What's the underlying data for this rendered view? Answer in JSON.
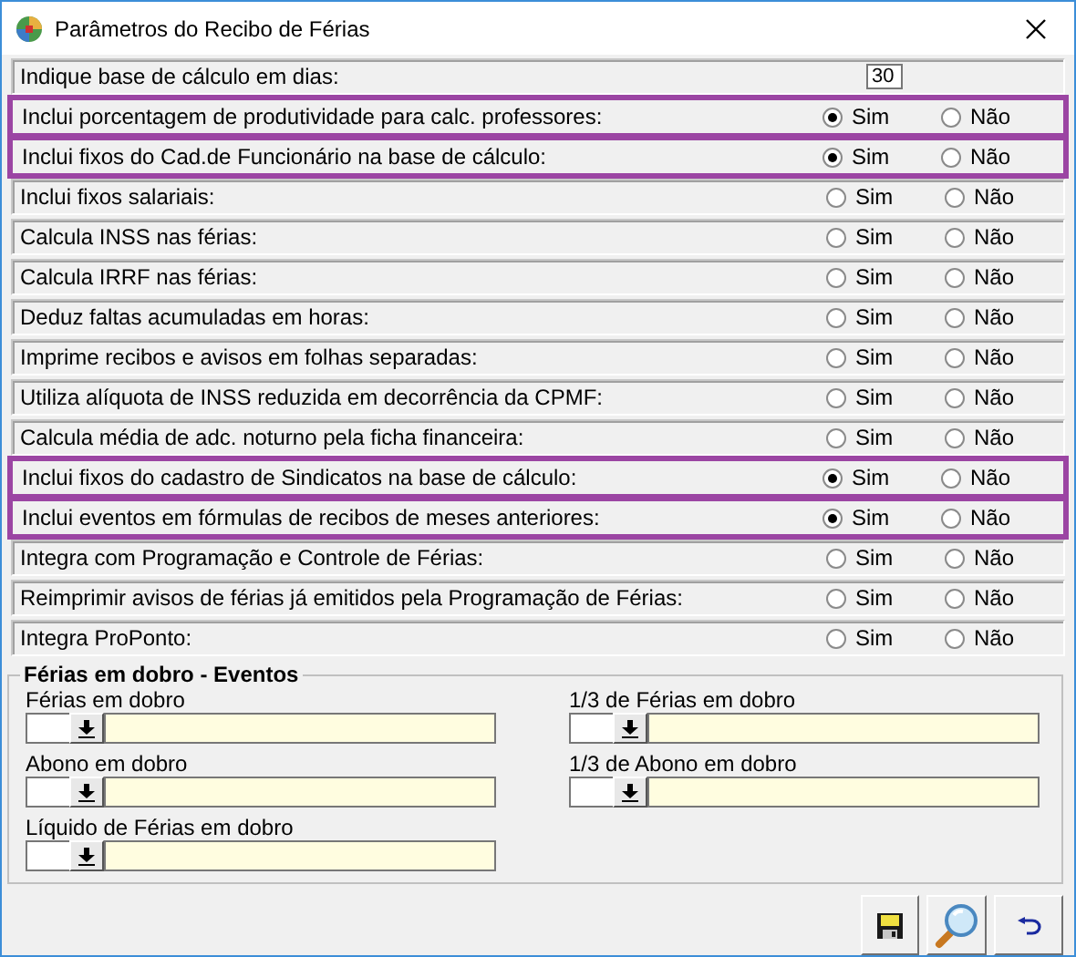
{
  "window": {
    "title": "Parâmetros do Recibo de Férias"
  },
  "parameters": [
    {
      "kind": "number",
      "label": "Indique base de cálculo em dias:",
      "value": "30",
      "highlighted": false
    },
    {
      "kind": "yes_no",
      "label": "Inclui porcentagem de produtividade para calc. professores:",
      "highlighted": true,
      "options": [
        {
          "label": "Sim",
          "selected": true
        },
        {
          "label": "Não",
          "selected": false
        }
      ]
    },
    {
      "kind": "yes_no",
      "label": "Inclui fixos do Cad.de Funcionário na base de cálculo:",
      "highlighted": true,
      "options": [
        {
          "label": "Sim",
          "selected": true
        },
        {
          "label": "Não",
          "selected": false
        }
      ]
    },
    {
      "kind": "yes_no",
      "label": "Inclui fixos salariais:",
      "highlighted": false,
      "options": [
        {
          "label": "Sim",
          "selected": false
        },
        {
          "label": "Não",
          "selected": false
        }
      ]
    },
    {
      "kind": "yes_no",
      "label": "Calcula INSS nas férias:",
      "highlighted": false,
      "options": [
        {
          "label": "Sim",
          "selected": false
        },
        {
          "label": "Não",
          "selected": false
        }
      ]
    },
    {
      "kind": "yes_no",
      "label": "Calcula IRRF nas férias:",
      "highlighted": false,
      "options": [
        {
          "label": "Sim",
          "selected": false
        },
        {
          "label": "Não",
          "selected": false
        }
      ]
    },
    {
      "kind": "yes_no",
      "label": "Deduz faltas acumuladas em horas:",
      "highlighted": false,
      "options": [
        {
          "label": "Sim",
          "selected": false
        },
        {
          "label": "Não",
          "selected": false
        }
      ]
    },
    {
      "kind": "yes_no",
      "label": "Imprime recibos e avisos em folhas separadas:",
      "highlighted": false,
      "options": [
        {
          "label": "Sim",
          "selected": false
        },
        {
          "label": "Não",
          "selected": false
        }
      ]
    },
    {
      "kind": "yes_no",
      "label": "Utiliza alíquota de INSS reduzida em decorrência da CPMF:",
      "highlighted": false,
      "options": [
        {
          "label": "Sim",
          "selected": false
        },
        {
          "label": "Não",
          "selected": false
        }
      ]
    },
    {
      "kind": "yes_no",
      "label": "Calcula média de adc. noturno pela ficha financeira:",
      "highlighted": false,
      "options": [
        {
          "label": "Sim",
          "selected": false
        },
        {
          "label": "Não",
          "selected": false
        }
      ]
    },
    {
      "kind": "yes_no",
      "label": "Inclui fixos do cadastro de Sindicatos na base de cálculo:",
      "highlighted": true,
      "options": [
        {
          "label": "Sim",
          "selected": true
        },
        {
          "label": "Não",
          "selected": false
        }
      ]
    },
    {
      "kind": "yes_no",
      "label": "Inclui eventos em fórmulas de recibos de meses anteriores:",
      "highlighted": true,
      "options": [
        {
          "label": "Sim",
          "selected": true
        },
        {
          "label": "Não",
          "selected": false
        }
      ]
    },
    {
      "kind": "yes_no",
      "label": "Integra com Programação e Controle de Férias:",
      "highlighted": false,
      "options": [
        {
          "label": "Sim",
          "selected": false
        },
        {
          "label": "Não",
          "selected": false
        }
      ]
    },
    {
      "kind": "yes_no",
      "label": "Reimprimir avisos de férias já emitidos pela Programação de Férias:",
      "highlighted": false,
      "options": [
        {
          "label": "Sim",
          "selected": false
        },
        {
          "label": "Não",
          "selected": false
        }
      ]
    },
    {
      "kind": "yes_no",
      "label": "Integra ProPonto:",
      "highlighted": false,
      "options": [
        {
          "label": "Sim",
          "selected": false
        },
        {
          "label": "Não",
          "selected": false
        }
      ]
    }
  ],
  "events": {
    "title": "Férias em dobro - Eventos",
    "fields": [
      {
        "label": "Férias em dobro"
      },
      {
        "label": "1/3 de Férias em dobro"
      },
      {
        "label": "Abono em dobro"
      },
      {
        "label": "1/3 de Abono em dobro"
      },
      {
        "label": "Líquido de Férias em dobro"
      }
    ]
  }
}
